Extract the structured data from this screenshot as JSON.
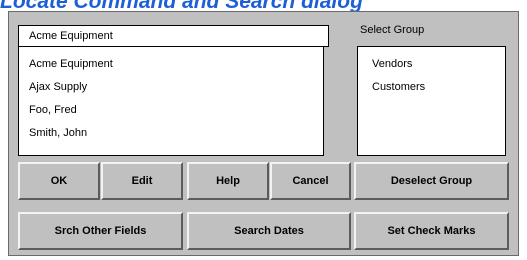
{
  "page": {
    "title": "Locate Command and Search dialog"
  },
  "search": {
    "value": "Acme Equipment"
  },
  "results": {
    "items": [
      "Acme Equipment",
      "Ajax Supply",
      "Foo, Fred",
      "Smith, John"
    ]
  },
  "groups": {
    "label": "Select Group",
    "items": [
      "Vendors",
      "Customers"
    ]
  },
  "buttons": {
    "ok": "OK",
    "edit": "Edit",
    "help": "Help",
    "cancel": "Cancel",
    "deselect_group": "Deselect Group",
    "search_other_fields": "Srch Other Fields",
    "search_dates": "Search Dates",
    "set_check_marks": "Set Check Marks"
  },
  "colors": {
    "title": "#1e5fd8",
    "dialog_bg": "#c0c0c0"
  }
}
